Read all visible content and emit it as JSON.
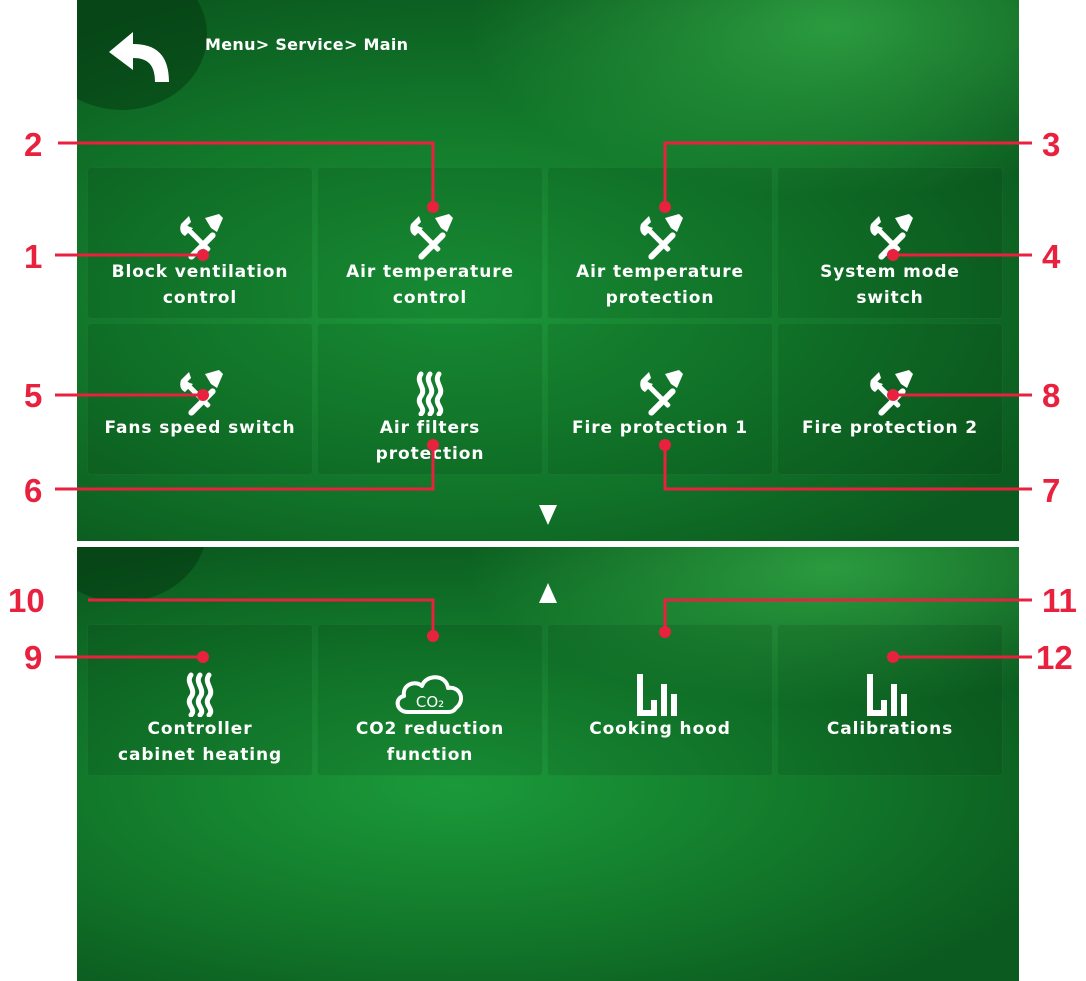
{
  "header": {
    "breadcrumb": "Menu> Service> Main",
    "back_icon": "back-arrow-icon"
  },
  "page1": {
    "tiles": [
      {
        "label": "Block ventilation\ncontrol",
        "icon": "wrench-screwdriver-icon"
      },
      {
        "label": "Air temperature\ncontrol",
        "icon": "wrench-screwdriver-icon"
      },
      {
        "label": "Air temperature\nprotection",
        "icon": "wrench-screwdriver-icon"
      },
      {
        "label": "System mode\nswitch",
        "icon": "wrench-screwdriver-icon"
      },
      {
        "label": "Fans speed switch",
        "icon": "wrench-screwdriver-icon"
      },
      {
        "label": "Air filters\nprotection",
        "icon": "heat-waves-icon"
      },
      {
        "label": "Fire protection 1",
        "icon": "wrench-screwdriver-icon"
      },
      {
        "label": "Fire protection 2",
        "icon": "wrench-screwdriver-icon"
      }
    ],
    "scroll_down_icon": "triangle-down-icon"
  },
  "page2": {
    "scroll_up_icon": "triangle-up-icon",
    "tiles": [
      {
        "label": "Controller\ncabinet heating",
        "icon": "heat-waves-icon"
      },
      {
        "label": "CO2 reduction\nfunction",
        "icon": "co2-cloud-icon",
        "icon_text": "CO₂"
      },
      {
        "label": "Cooking hood",
        "icon": "bar-chart-icon"
      },
      {
        "label": "Calibrations",
        "icon": "bar-chart-icon"
      }
    ]
  },
  "callouts": [
    "1",
    "2",
    "3",
    "4",
    "5",
    "6",
    "7",
    "8",
    "9",
    "10",
    "11",
    "12"
  ],
  "colors": {
    "callout": "#e8213f",
    "background_green": "#158a33",
    "text": "#ffffff"
  }
}
